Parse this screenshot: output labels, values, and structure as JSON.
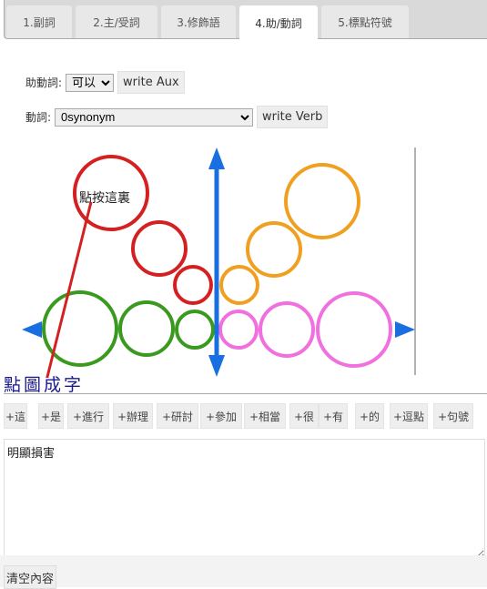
{
  "tabs": [
    {
      "label": "1.副詞"
    },
    {
      "label": "2.主/受詞"
    },
    {
      "label": "3.修飾語"
    },
    {
      "label": "4.助/動詞",
      "active": true
    },
    {
      "label": "5.標點符號"
    }
  ],
  "aux": {
    "label": "助動詞:",
    "value": "可以",
    "button": "write Aux"
  },
  "verb": {
    "label": "動詞:",
    "value": "0synonym",
    "button": "write Verb"
  },
  "diagram": {
    "annotation": "點按這裏",
    "colors": {
      "red": "#d42020",
      "orange": "#f0a020",
      "green": "#3a9a20",
      "pink": "#f070e0",
      "blue": "#1a6fe0"
    }
  },
  "section_title": "點圖成字",
  "word_buttons": [
    "+這",
    "+是",
    "+進行",
    "+辦理",
    "+研討",
    "+參加",
    "+相當",
    "+很",
    "+有",
    "+的",
    "+逗點",
    "+句號"
  ],
  "textarea_value": "明顯損害",
  "clear_button": "清空內容"
}
